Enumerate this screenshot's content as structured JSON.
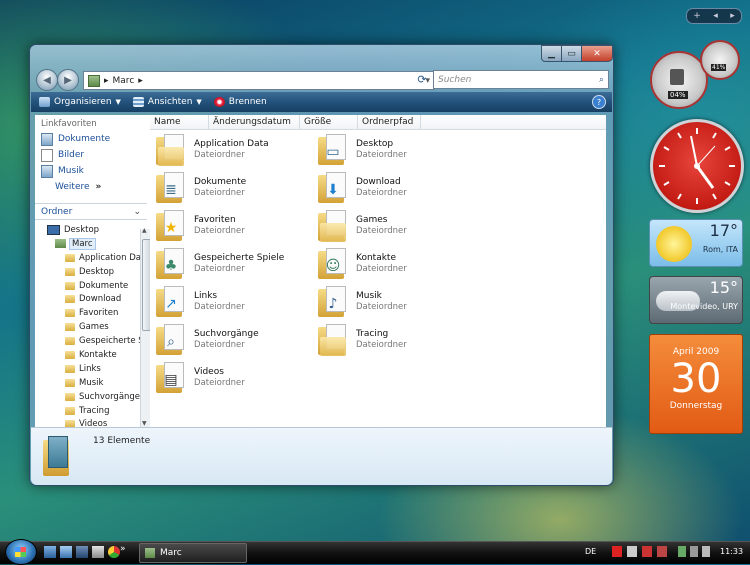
{
  "window": {
    "title_buttons": {
      "minimize": "▁",
      "maximize": "▭",
      "close": "✕"
    },
    "address": {
      "path": [
        "Marc"
      ],
      "separator": "▸"
    },
    "search": {
      "placeholder": "Suchen"
    },
    "toolbar": [
      {
        "label": "Organisieren",
        "icon": "organize-icon",
        "dropdown": true
      },
      {
        "label": "Ansichten",
        "icon": "views-icon",
        "dropdown": true
      },
      {
        "label": "Brennen",
        "icon": "burn-icon",
        "dropdown": false
      }
    ],
    "help_icon": "?"
  },
  "nav": {
    "favorites_header": "Linkfavoriten",
    "favorites": [
      {
        "label": "Dokumente",
        "icon": "documents-icon"
      },
      {
        "label": "Bilder",
        "icon": "pictures-icon"
      },
      {
        "label": "Musik",
        "icon": "music-icon"
      }
    ],
    "more": "Weitere",
    "more_arrows": "»",
    "folders_header": "Ordner",
    "tree_root": "Desktop",
    "tree_user": "Marc",
    "tree_items": [
      "Application Da",
      "Desktop",
      "Dokumente",
      "Download",
      "Favoriten",
      "Games",
      "Gespeicherte S",
      "Kontakte",
      "Links",
      "Musik",
      "Suchvorgänge",
      "Tracing",
      "Videos"
    ]
  },
  "columns": [
    "Name",
    "Änderungsdatum",
    "Größe",
    "Ordnerpfad"
  ],
  "files": [
    {
      "name": "Application Data",
      "type": "Dateiordner",
      "icon": "folder-icon"
    },
    {
      "name": "Desktop",
      "type": "Dateiordner",
      "icon": "desktop-folder-icon"
    },
    {
      "name": "Dokumente",
      "type": "Dateiordner",
      "icon": "documents-folder-icon"
    },
    {
      "name": "Download",
      "type": "Dateiordner",
      "icon": "download-folder-icon"
    },
    {
      "name": "Favoriten",
      "type": "Dateiordner",
      "icon": "favorites-folder-icon"
    },
    {
      "name": "Games",
      "type": "Dateiordner",
      "icon": "folder-icon"
    },
    {
      "name": "Gespeicherte Spiele",
      "type": "Dateiordner",
      "icon": "saved-games-folder-icon"
    },
    {
      "name": "Kontakte",
      "type": "Dateiordner",
      "icon": "contacts-folder-icon"
    },
    {
      "name": "Links",
      "type": "Dateiordner",
      "icon": "links-folder-icon"
    },
    {
      "name": "Musik",
      "type": "Dateiordner",
      "icon": "music-folder-icon"
    },
    {
      "name": "Suchvorgänge",
      "type": "Dateiordner",
      "icon": "searches-folder-icon"
    },
    {
      "name": "Tracing",
      "type": "Dateiordner",
      "icon": "folder-icon"
    },
    {
      "name": "Videos",
      "type": "Dateiordner",
      "icon": "videos-folder-icon"
    }
  ],
  "details": {
    "count_text": "13 Elemente"
  },
  "taskbar": {
    "window_button": "Marc",
    "chevron": "»",
    "language": "DE",
    "time": "11:33"
  },
  "sidebar_gadgets": {
    "controls": {
      "add": "+",
      "prev": "◂",
      "next": "▸"
    },
    "cpu_meter": {
      "cpu_percent": "04%",
      "ram_percent": "41%"
    },
    "weather1": {
      "temp": "17°",
      "location": "Rom, ITA"
    },
    "weather2": {
      "temp": "15°",
      "location": "Montevideo, URY"
    },
    "calendar": {
      "month_year": "April 2009",
      "day": "30",
      "weekday": "Donnerstag"
    }
  },
  "colors": {
    "accent": "#1b4f99",
    "toolbar": "#23527c",
    "calendar": "#e25b14",
    "clock": "#c41c14"
  }
}
